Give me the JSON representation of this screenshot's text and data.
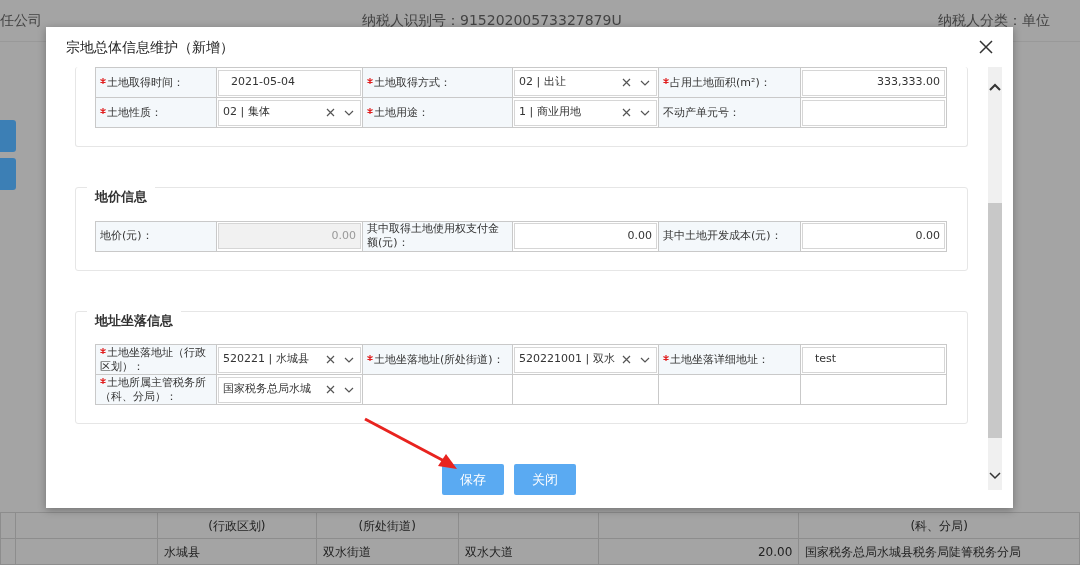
{
  "background": {
    "company_fragment": "任公司",
    "taxpayer_id": "纳税人识别号：91520200573327879U",
    "taxpayer_type": "纳税人分类：单位",
    "table": {
      "columns": [
        {},
        {},
        {
          "header": "(行政区划)",
          "value": "水城县"
        },
        {
          "header": "(所处街道)",
          "value": "双水街道"
        },
        {
          "value": "双水大道"
        },
        {
          "value": "20.00",
          "kind": "number"
        },
        {
          "header": "(科、分局)",
          "value": "国家税务总局水城县税务局陡箐税务分局"
        }
      ]
    }
  },
  "dialog": {
    "title": "宗地总体信息维护（新增）",
    "sections": [
      {
        "rows": [
          [
            {
              "kind": "label",
              "text": "土地取得时间：",
              "required": true
            },
            {
              "kind": "text",
              "value": "2021-05-04"
            },
            {
              "kind": "label",
              "text": "土地取得方式：",
              "required": true
            },
            {
              "kind": "select",
              "value": "02 | 出让"
            },
            {
              "kind": "label",
              "text": "占用土地面积(m²)：",
              "required": true
            },
            {
              "kind": "number",
              "value": "333,333.00",
              "disabled": false
            }
          ],
          [
            {
              "kind": "label",
              "text": "土地性质：",
              "required": true
            },
            {
              "kind": "select",
              "value": "02 | 集体"
            },
            {
              "kind": "label",
              "text": "土地用途：",
              "required": true
            },
            {
              "kind": "select",
              "value": "1 | 商业用地"
            },
            {
              "kind": "label",
              "text": "不动产单元号：",
              "required": false
            },
            {
              "kind": "text"
            }
          ]
        ]
      },
      {
        "title": "地价信息",
        "rows": [
          [
            {
              "kind": "label",
              "text": "地价(元)：",
              "required": false
            },
            {
              "kind": "number",
              "value": "0.00",
              "disabled": true
            },
            {
              "kind": "label",
              "text": "其中取得土地使用权支付金额(元)：",
              "required": false
            },
            {
              "kind": "number",
              "value": "0.00",
              "disabled": false
            },
            {
              "kind": "label",
              "text": "其中土地开发成本(元)：",
              "required": false
            },
            {
              "kind": "number",
              "value": "0.00",
              "disabled": false
            }
          ]
        ]
      },
      {
        "title": "地址坐落信息",
        "rows": [
          [
            {
              "kind": "label",
              "text": "土地坐落地址（行政区划）：",
              "required": true
            },
            {
              "kind": "select",
              "value": "520221 | 水城县"
            },
            {
              "kind": "label",
              "text": "土地坐落地址(所处街道)：",
              "required": true
            },
            {
              "kind": "select",
              "value": "520221001 | 双水"
            },
            {
              "kind": "label",
              "text": "土地坐落详细地址：",
              "required": true
            },
            {
              "kind": "text",
              "value": "test"
            }
          ],
          [
            {
              "kind": "label",
              "text": "土地所属主管税务所（科、分局）：",
              "required": true
            },
            {
              "kind": "select",
              "value": "国家税务总局水城"
            },
            {
              "kind": "blank"
            },
            {
              "kind": "blank"
            },
            {
              "kind": "blank"
            },
            {
              "kind": "blank"
            }
          ]
        ]
      }
    ],
    "buttons": [
      "保存",
      "关闭"
    ]
  }
}
